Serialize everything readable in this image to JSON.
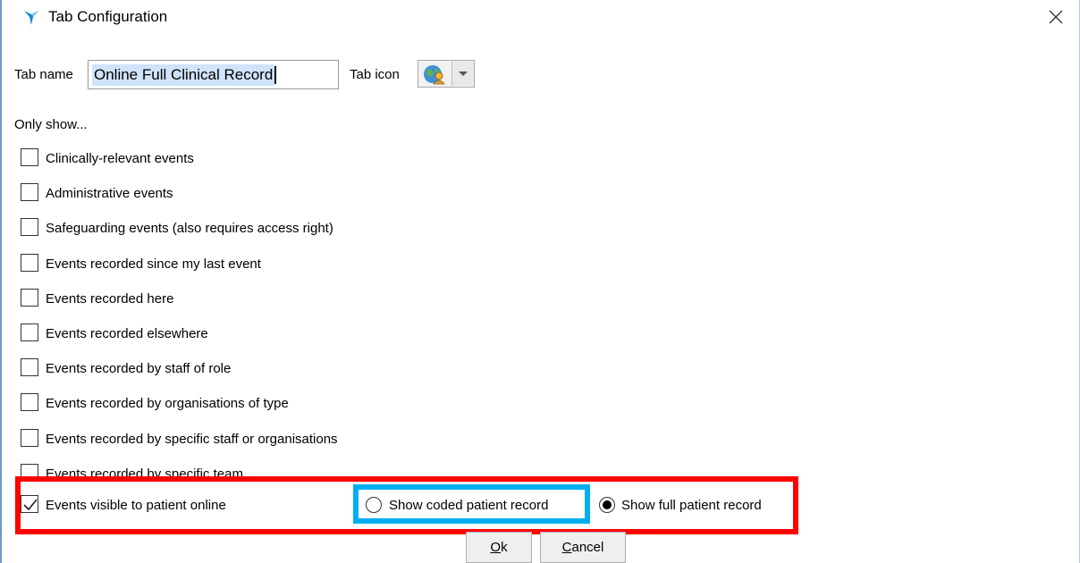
{
  "window": {
    "title": "Tab Configuration",
    "app_icon": "emis-logo-icon",
    "close_icon": "close-icon"
  },
  "tab_name": {
    "label": "Tab name",
    "value": "Online Full Clinical Record"
  },
  "tab_icon": {
    "label": "Tab icon",
    "icon": "globe-person-icon",
    "dropdown_icon": "chevron-down-icon"
  },
  "only_show_label": "Only show...",
  "filters": [
    {
      "label": "Clinically-relevant events",
      "checked": false
    },
    {
      "label": "Administrative events",
      "checked": false
    },
    {
      "label": "Safeguarding events (also requires access right)",
      "checked": false
    },
    {
      "label": "Events recorded since my last event",
      "checked": false
    },
    {
      "label": "Events recorded here",
      "checked": false
    },
    {
      "label": "Events recorded elsewhere",
      "checked": false
    },
    {
      "label": "Events recorded by staff of role",
      "checked": false
    },
    {
      "label": "Events recorded by organisations of type",
      "checked": false
    },
    {
      "label": "Events recorded by specific staff or organisations",
      "checked": false
    },
    {
      "label": "Events recorded by specific team",
      "checked": false
    }
  ],
  "patient_online": {
    "label": "Events visible to patient online",
    "checked": true,
    "options": [
      {
        "label": "Show coded patient record",
        "selected": false
      },
      {
        "label": "Show full patient record",
        "selected": true
      }
    ]
  },
  "annotation_colors": {
    "outer_highlight": "#ff0000",
    "inner_highlight": "#00aeef"
  },
  "buttons": {
    "ok": {
      "mnemonic": "O",
      "rest": "k"
    },
    "cancel": {
      "mnemonic": "C",
      "rest": "ancel"
    }
  }
}
